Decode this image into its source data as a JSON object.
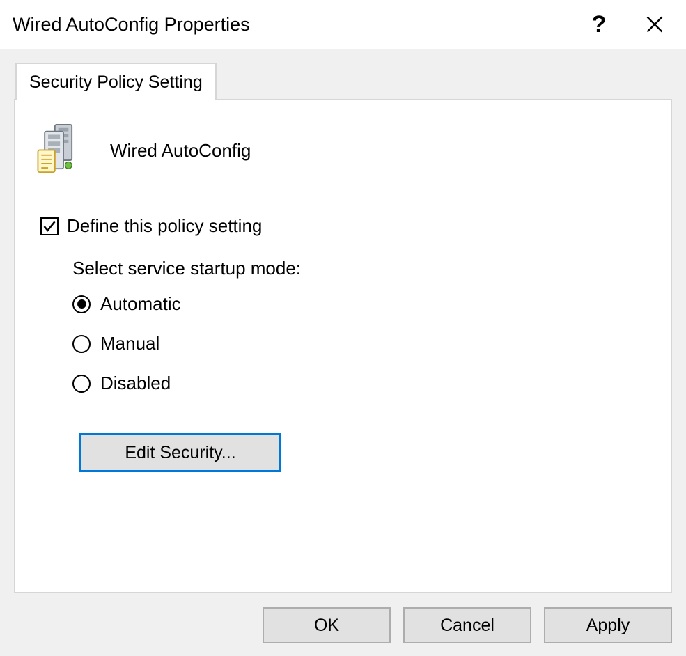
{
  "window": {
    "title": "Wired AutoConfig Properties"
  },
  "tab": {
    "label": "Security Policy Setting"
  },
  "service": {
    "name": "Wired AutoConfig"
  },
  "policy": {
    "define_label": "Define this policy setting",
    "define_checked": true,
    "startup_label": "Select service startup mode:",
    "options": {
      "automatic": "Automatic",
      "manual": "Manual",
      "disabled": "Disabled"
    },
    "selected": "automatic",
    "edit_security_label": "Edit Security..."
  },
  "buttons": {
    "ok": "OK",
    "cancel": "Cancel",
    "apply": "Apply"
  }
}
